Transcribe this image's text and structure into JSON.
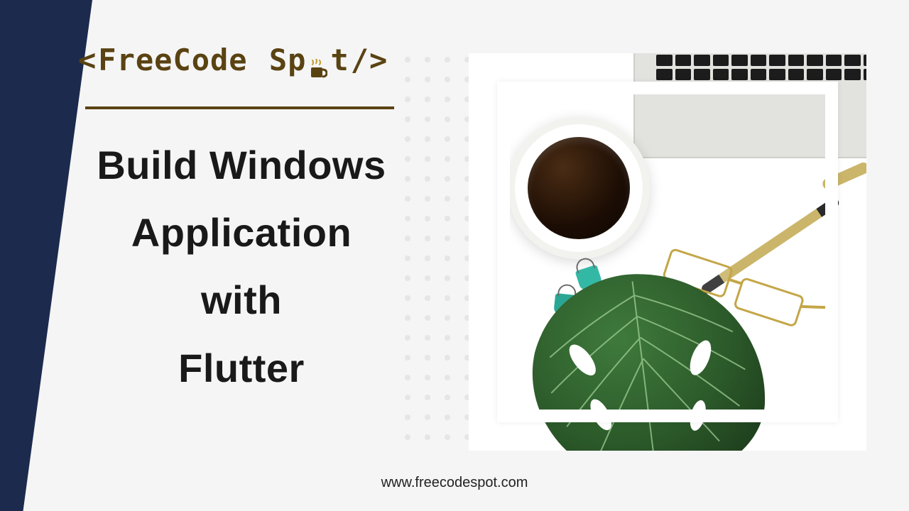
{
  "logo": {
    "prefix": "<",
    "word1": "FreeCode",
    "word2": "Sp",
    "word3": "t",
    "suffix": "/>"
  },
  "headline": {
    "line1": "Build Windows",
    "line2": "Application",
    "line3": "with",
    "line4": "Flutter"
  },
  "footer": {
    "url": "www.freecodespot.com"
  },
  "colors": {
    "navy": "#1c2a4e",
    "brand": "#5a4312",
    "bg": "#f5f5f5"
  }
}
